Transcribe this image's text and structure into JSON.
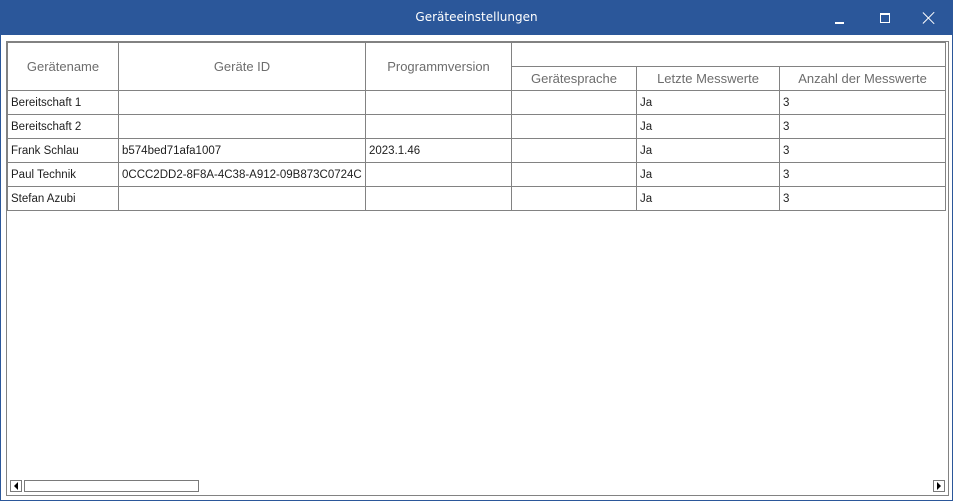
{
  "window": {
    "title": "Geräteeinstellungen",
    "accent_color": "#2b579a"
  },
  "grid": {
    "columns": [
      "Gerätename",
      "Geräte ID",
      "Programmversion",
      "Gerätesprache",
      "Letzte Messwerte",
      "Anzahl der Messwerte"
    ],
    "group_header": "",
    "rows": [
      [
        "Bereitschaft 1",
        "",
        "",
        "",
        "Ja",
        "3"
      ],
      [
        "Bereitschaft 2",
        "",
        "",
        "",
        "Ja",
        "3"
      ],
      [
        "Frank Schlau",
        "b574bed71afa1007",
        "2023.1.46",
        "",
        "Ja",
        "3"
      ],
      [
        "Paul Technik",
        "0CCC2DD2-8F8A-4C38-A912-09B873C0724C",
        "",
        "",
        "Ja",
        "3"
      ],
      [
        "Stefan Azubi",
        "",
        "",
        "",
        "Ja",
        "3"
      ]
    ]
  }
}
